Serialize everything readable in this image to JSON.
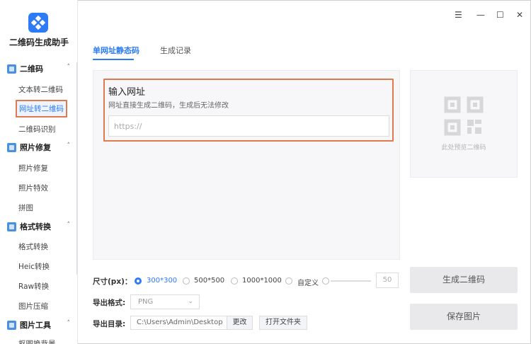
{
  "app": {
    "name": "二维码生成助手"
  },
  "window": {
    "menu": "☰",
    "minimize": "—",
    "maximize": "☐",
    "close": "✕"
  },
  "sidebar": {
    "sections": [
      {
        "label": "二维码",
        "caret": "˄",
        "items": [
          "文本转二维码",
          "网址转二维码",
          "二维码识别"
        ]
      },
      {
        "label": "照片修复",
        "caret": "˄",
        "items": [
          "照片修复",
          "照片特效",
          "拼图"
        ]
      },
      {
        "label": "格式转换",
        "caret": "˄",
        "items": [
          "格式转换",
          "Heic转换",
          "Raw转换",
          "图片压缩"
        ]
      },
      {
        "label": "图片工具",
        "caret": "˄",
        "items": [
          "抠图换背景"
        ]
      }
    ]
  },
  "tabs": [
    {
      "label": "单网址静态码",
      "active": true
    },
    {
      "label": "生成记录",
      "active": false
    }
  ],
  "input_section": {
    "title": "输入网址",
    "subtitle": "网址直接生成二维码，生成后无法修改",
    "value": "",
    "placeholder": "https://"
  },
  "preview": {
    "text": "此处预览二维码"
  },
  "settings": {
    "size_label": "尺寸(px)：",
    "size_options": [
      {
        "label": "300*300",
        "checked": true
      },
      {
        "label": "500*500",
        "checked": false
      },
      {
        "label": "1000*1000",
        "checked": false
      },
      {
        "label": "自定义",
        "checked": false
      }
    ],
    "custom_size_value": "50",
    "format_label": "导出格式:",
    "format_value": "PNG",
    "format_caret": "⌄",
    "dir_label": "导出目录:",
    "dir_value": "C:\\Users\\Admin\\Desktop",
    "change_label": "更改",
    "open_folder_label": "打开文件夹"
  },
  "buttons": {
    "generate": "生成二维码",
    "save": "保存图片"
  },
  "colors": {
    "accent": "#2d7cf6",
    "highlight": "#e07a4c"
  }
}
